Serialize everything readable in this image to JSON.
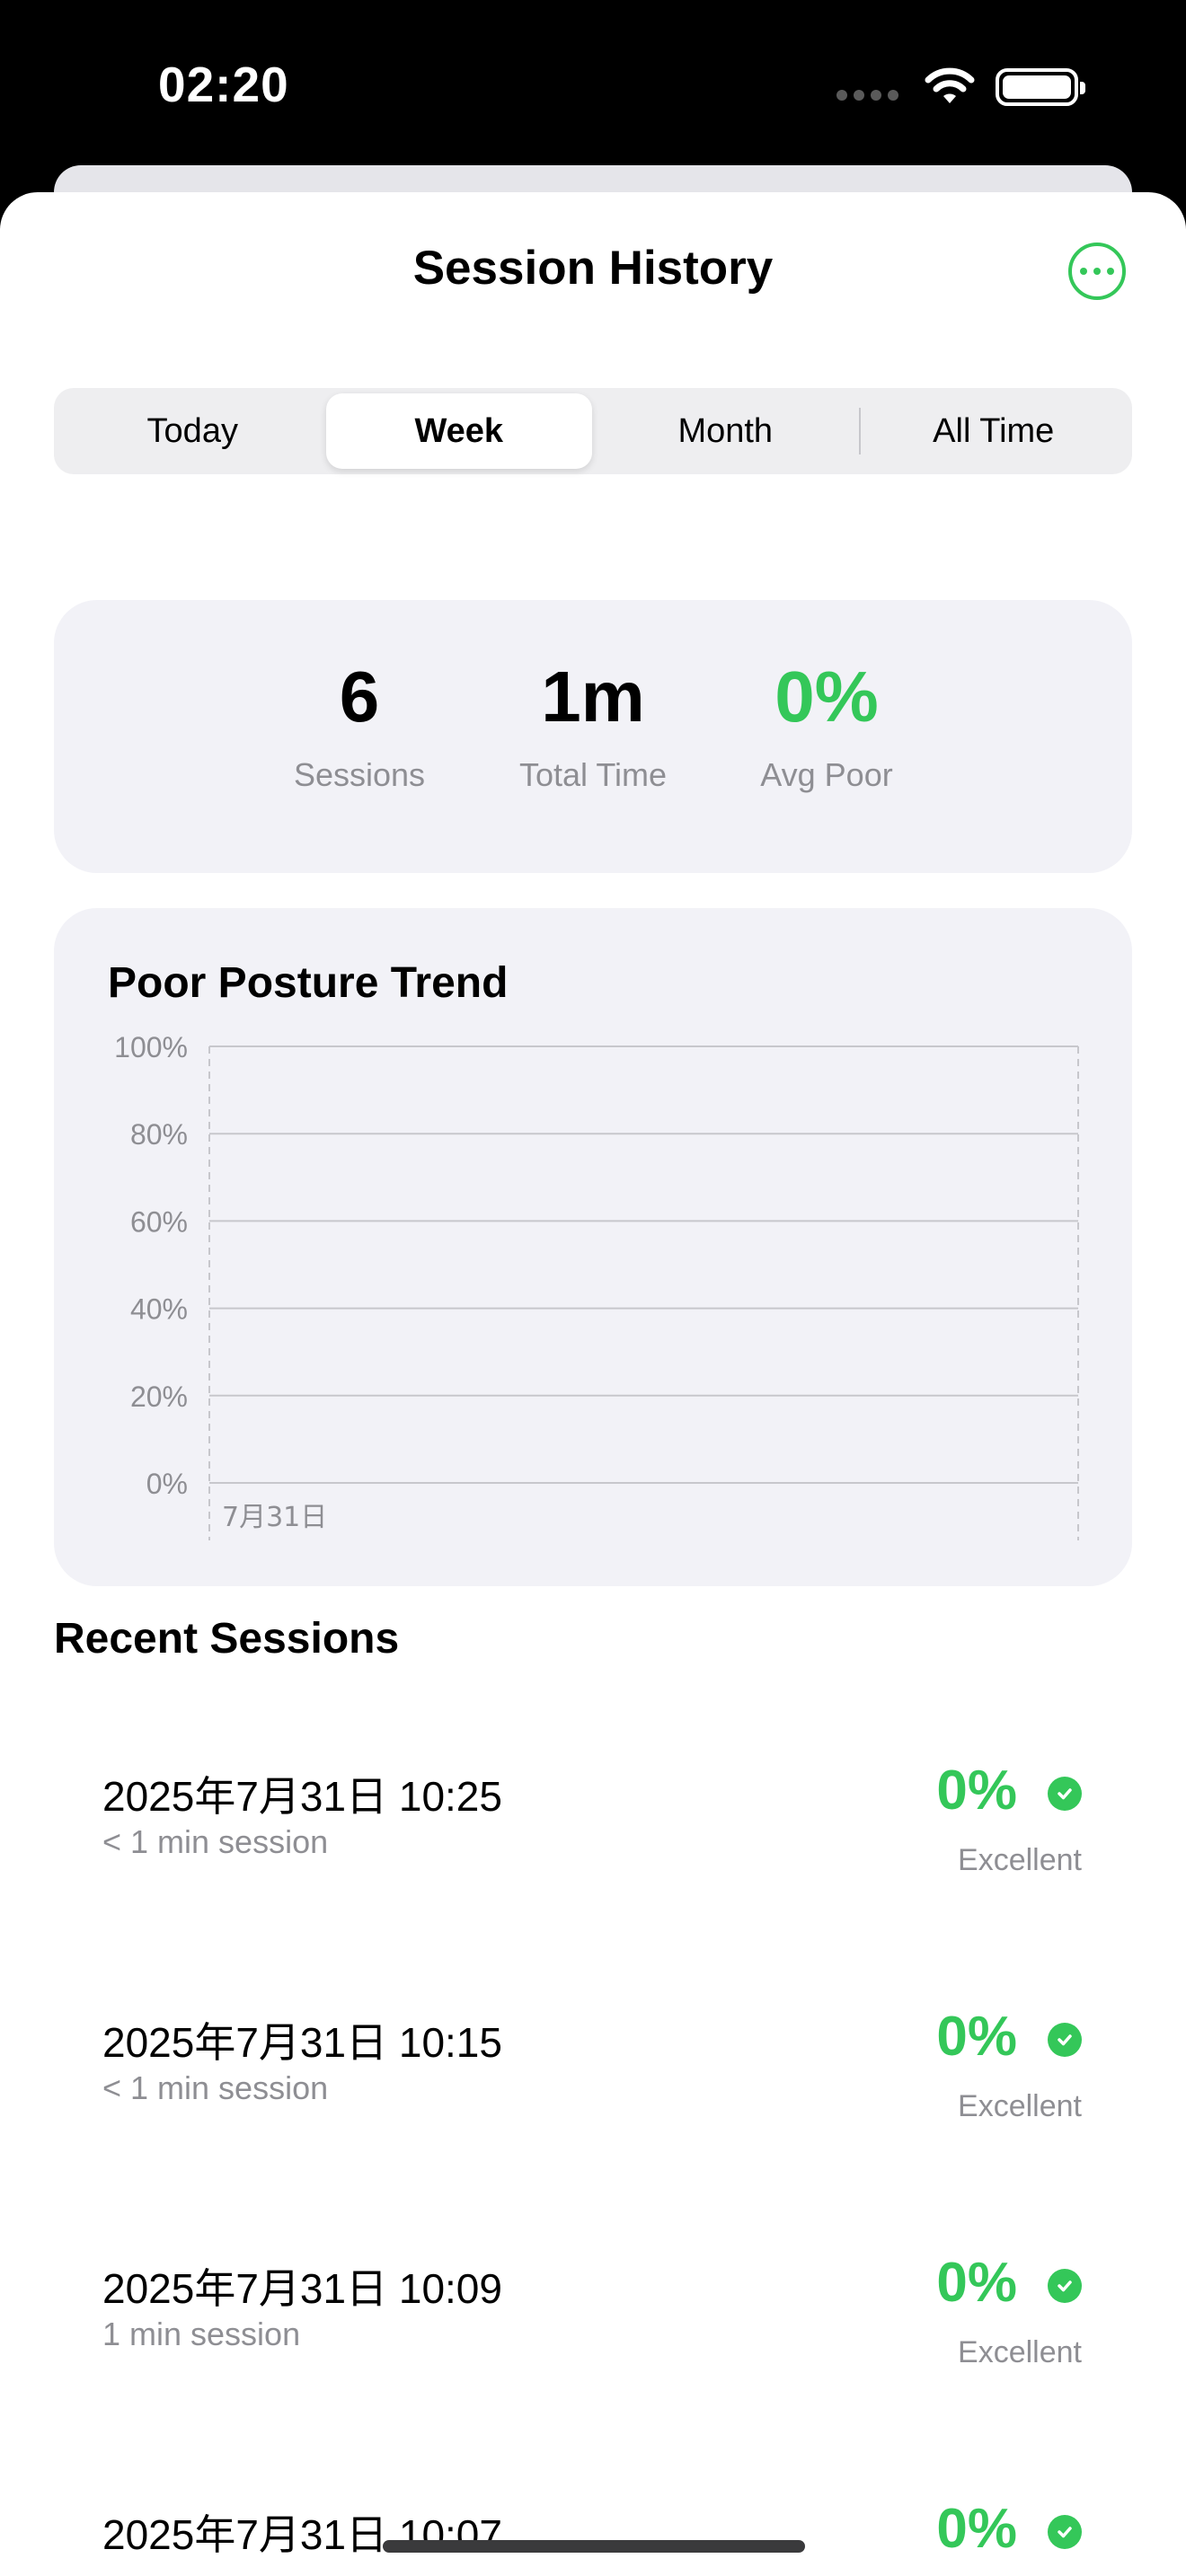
{
  "status_bar": {
    "time": "02:20"
  },
  "sheet": {
    "title": "Session History"
  },
  "tabs": [
    {
      "label": "Today",
      "selected": false
    },
    {
      "label": "Week",
      "selected": true
    },
    {
      "label": "Month",
      "selected": false
    },
    {
      "label": "All Time",
      "selected": false
    }
  ],
  "summary": {
    "sessions_value": "6",
    "sessions_label": "Sessions",
    "total_time_value": "1m",
    "total_time_label": "Total Time",
    "avg_poor_value": "0%",
    "avg_poor_label": "Avg Poor"
  },
  "chart_data": {
    "type": "line",
    "title": "Poor Posture Trend",
    "y_ticks": [
      "100%",
      "80%",
      "60%",
      "40%",
      "20%",
      "0%"
    ],
    "ylim": [
      0,
      100
    ],
    "x_tick_labels": [
      "7月31日"
    ],
    "series": [],
    "grid": true
  },
  "recent": {
    "header": "Recent Sessions",
    "sessions": [
      {
        "date": "2025年7月31日 10:25",
        "duration": "< 1 min session",
        "score": "0%",
        "rating": "Excellent"
      },
      {
        "date": "2025年7月31日 10:15",
        "duration": "< 1 min session",
        "score": "0%",
        "rating": "Excellent"
      },
      {
        "date": "2025年7月31日 10:09",
        "duration": "1 min session",
        "score": "0%",
        "rating": "Excellent"
      },
      {
        "date": "2025年7月31日 10:07",
        "duration": "",
        "score": "0%",
        "rating": ""
      }
    ]
  },
  "colors": {
    "accent": "#34c759",
    "card_bg": "#f2f2f7",
    "secondary_text": "#8e8e93"
  }
}
